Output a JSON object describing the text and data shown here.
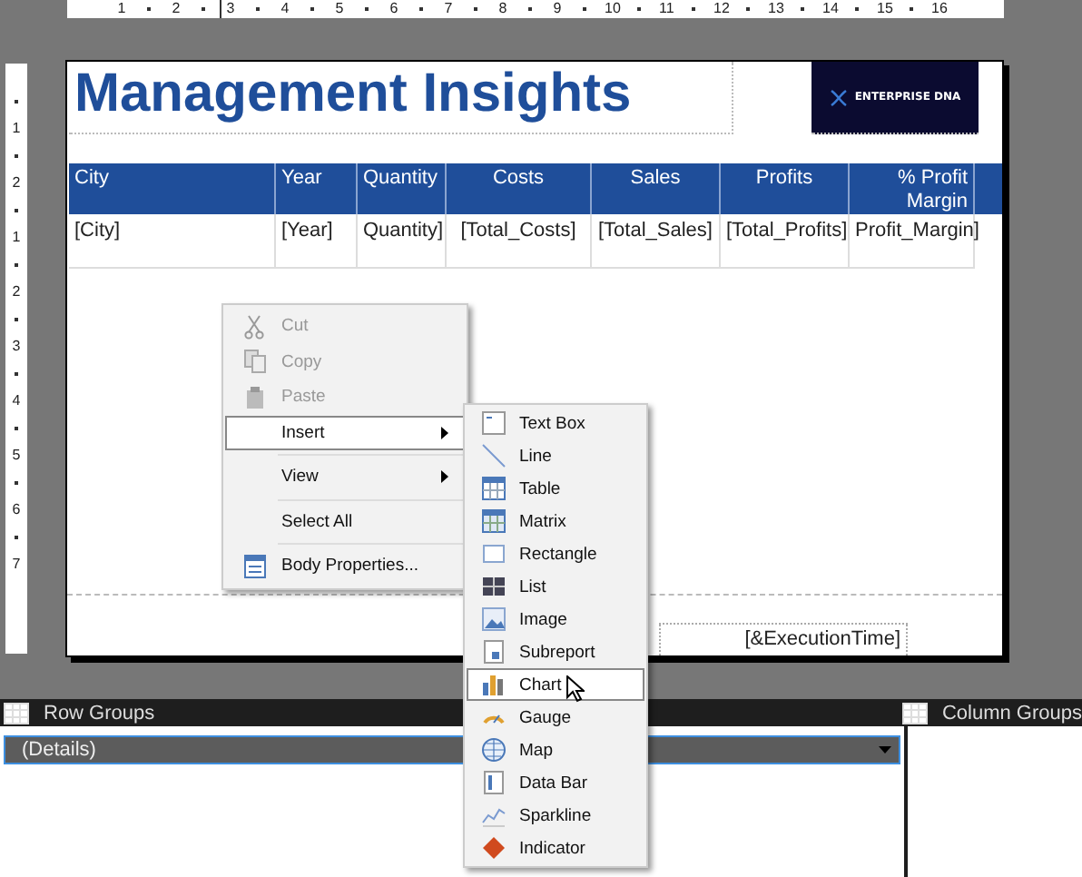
{
  "top_ruler": {
    "labels": [
      "1",
      "2",
      "3",
      "4",
      "5",
      "6",
      "7",
      "8",
      "9",
      "10",
      "11",
      "12",
      "13",
      "14",
      "15",
      "16"
    ]
  },
  "left_ruler": {
    "labels": [
      "1",
      "2",
      "1",
      "2",
      "3",
      "4",
      "5",
      "6",
      "7"
    ]
  },
  "report": {
    "title": "Management Insights",
    "logo_text": "ENTERPRISE DNA",
    "table": {
      "columns": [
        {
          "label": "City"
        },
        {
          "label": "Year"
        },
        {
          "label": "Quantity"
        },
        {
          "label": "Costs"
        },
        {
          "label": "Sales"
        },
        {
          "label": "Profits"
        },
        {
          "label": "% Profit Margin"
        }
      ],
      "rows": [
        [
          "[City]",
          "[Year]",
          "Quantity]",
          "[Total_Costs]",
          "[Total_Sales]",
          "[Total_Profits]",
          "Profit_Margin]"
        ]
      ]
    },
    "footer": {
      "execution_time": "[&ExecutionTime]"
    }
  },
  "context_menu": {
    "items": [
      {
        "kind": "item",
        "label": "Cut",
        "disabled": true,
        "selected": false,
        "submenu": false
      },
      {
        "kind": "item",
        "label": "Copy",
        "disabled": true,
        "selected": false,
        "submenu": false
      },
      {
        "kind": "item",
        "label": "Paste",
        "disabled": true,
        "selected": false,
        "submenu": false
      },
      {
        "kind": "item",
        "label": "Insert",
        "disabled": false,
        "selected": true,
        "submenu": true
      },
      {
        "kind": "separator"
      },
      {
        "kind": "item",
        "label": "View",
        "disabled": false,
        "selected": false,
        "submenu": true
      },
      {
        "kind": "separator"
      },
      {
        "kind": "item",
        "label": "Select All",
        "disabled": false,
        "selected": false,
        "submenu": false
      },
      {
        "kind": "separator"
      },
      {
        "kind": "item",
        "label": "Body Properties...",
        "disabled": false,
        "selected": false,
        "submenu": false
      }
    ]
  },
  "insert_submenu": {
    "items": [
      {
        "label": "Text Box",
        "selected": false
      },
      {
        "label": "Line",
        "selected": false
      },
      {
        "label": "Table",
        "selected": false
      },
      {
        "label": "Matrix",
        "selected": false
      },
      {
        "label": "Rectangle",
        "selected": false
      },
      {
        "label": "List",
        "selected": false
      },
      {
        "label": "Image",
        "selected": false
      },
      {
        "label": "Subreport",
        "selected": false
      },
      {
        "label": "Chart",
        "selected": true
      },
      {
        "label": "Gauge",
        "selected": false
      },
      {
        "label": "Map",
        "selected": false
      },
      {
        "label": "Data Bar",
        "selected": false
      },
      {
        "label": "Sparkline",
        "selected": false
      },
      {
        "label": "Indicator",
        "selected": false
      }
    ]
  },
  "grouping": {
    "row_groups": {
      "title": "Row Groups",
      "items": [
        {
          "label": "(Details)",
          "selected": true
        }
      ]
    },
    "column_groups": {
      "title": "Column Groups"
    }
  }
}
